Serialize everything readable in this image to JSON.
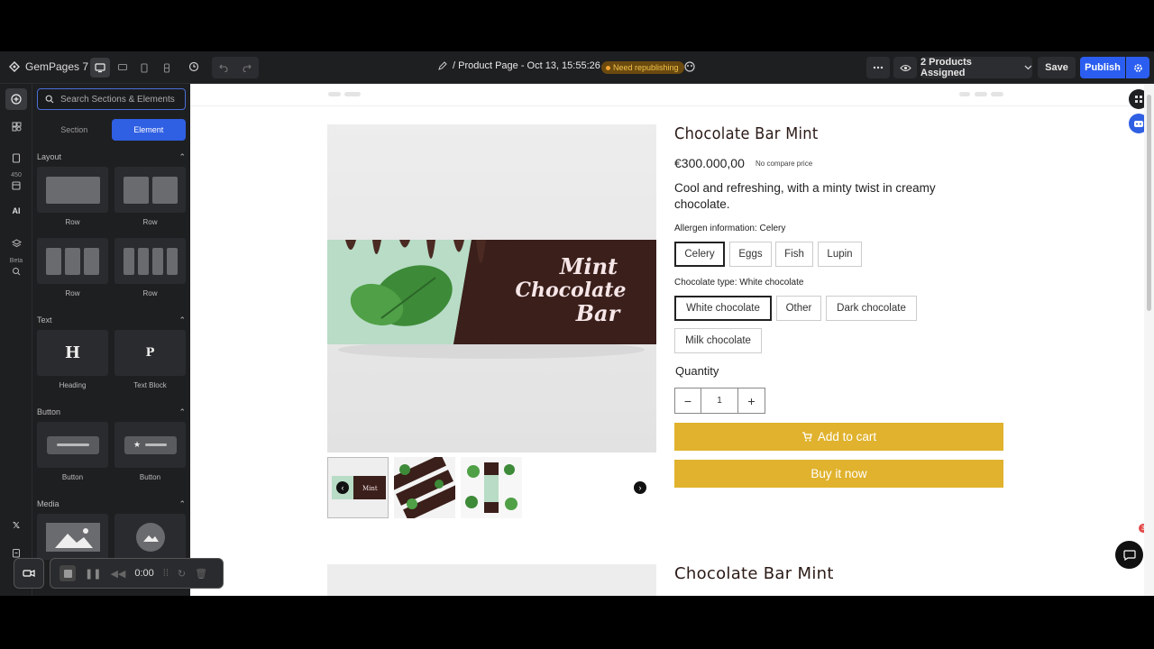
{
  "app": {
    "logo_text": "GemPages 7",
    "page_title": "/ Product Page - Oct 13, 15:55:26",
    "status_badge": "Need republishing",
    "assigned": "2 Products Assigned",
    "save": "Save",
    "publish": "Publish",
    "brand_color": "#2b5ef0"
  },
  "rail": {
    "count_badge": "450",
    "ai_label": "AI",
    "beta_label": "Beta"
  },
  "panel": {
    "search_placeholder": "Search Sections & Elements",
    "tabs": [
      "Section",
      "Element"
    ],
    "active_tab": "Element",
    "categories": {
      "layout": "Layout",
      "text": "Text",
      "button": "Button",
      "media": "Media"
    },
    "layout_items": [
      "Row",
      "Row",
      "Row",
      "Row"
    ],
    "text_items": [
      "Heading",
      "Text Block"
    ],
    "text_glyphs": [
      "H",
      "P"
    ],
    "button_items": [
      "Button",
      "Button"
    ]
  },
  "product": {
    "title": "Chocolate Bar Mint",
    "price": "€300.000,00",
    "compare": "No compare price",
    "description": "Cool and refreshing, with a minty twist in creamy chocolate.",
    "allergen_label": "Allergen information: Celery",
    "allergens": [
      "Celery",
      "Eggs",
      "Fish",
      "Lupin"
    ],
    "selected_allergen": "Celery",
    "type_label": "Chocolate type: White chocolate",
    "types": [
      "White chocolate",
      "Other",
      "Dark chocolate",
      "Milk chocolate"
    ],
    "selected_type": "White chocolate",
    "quantity_label": "Quantity",
    "quantity": "1",
    "add_to_cart": "Add to cart",
    "buy_now": "Buy it now",
    "packaging_text": [
      "Mint",
      "Chocolate",
      "Bar"
    ],
    "accent_color": "#e0b22d",
    "second_title": "Chocolate Bar Mint"
  },
  "chat": {
    "badge": "3"
  },
  "recorder": {
    "time": "0:00"
  }
}
